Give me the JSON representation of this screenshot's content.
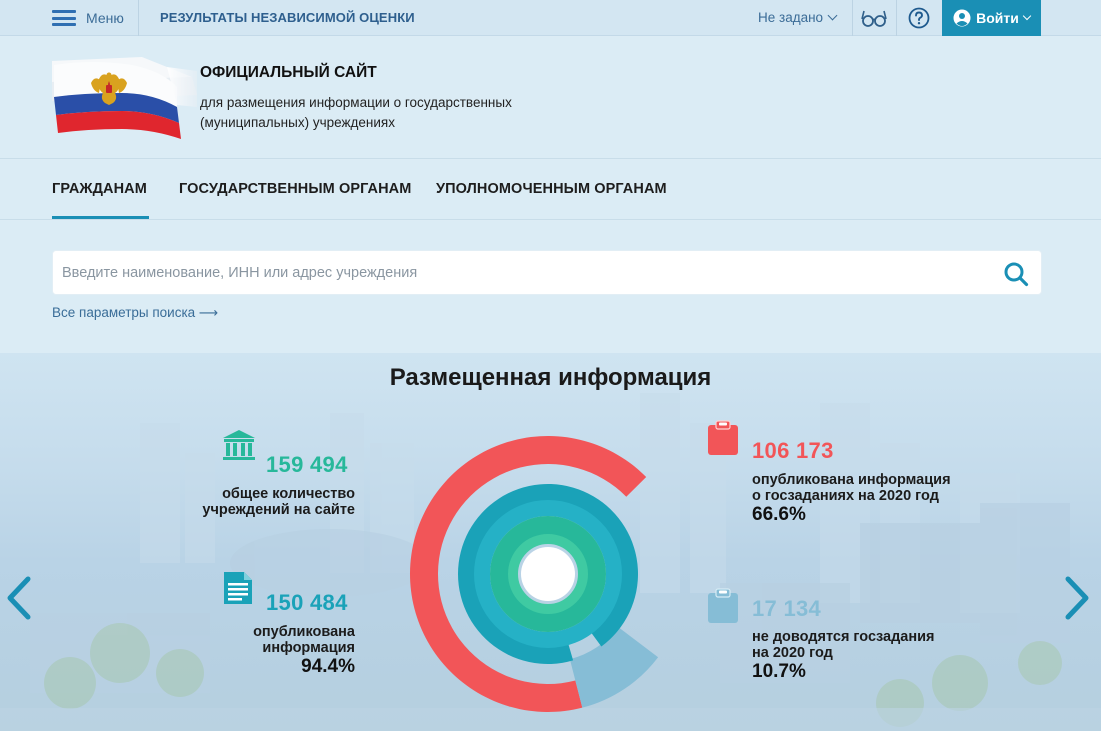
{
  "topbar": {
    "menu_label": "Меню",
    "results_link": "РЕЗУЛЬТАТЫ НЕЗАВИСИМОЙ ОЦЕНКИ",
    "region_label": "Не задано",
    "login_label": "Войти"
  },
  "header": {
    "site_title": "ОФИЦИАЛЬНЫЙ САЙТ",
    "site_subtitle": "для размещения информации о государственных (муниципальных) учреждениях"
  },
  "tabs": [
    {
      "label": "ГРАЖДАНАМ",
      "active": true
    },
    {
      "label": "ГОСУДАРСТВЕННЫМ ОРГАНАМ",
      "active": false
    },
    {
      "label": "УПОЛНОМОЧЕННЫМ ОРГАНАМ",
      "active": false
    }
  ],
  "search": {
    "placeholder": "Введите наименование, ИНН или адрес учреждения",
    "advanced_link": "Все параметры поиска ⟶"
  },
  "hero": {
    "title": "Размещенная информация",
    "stats": {
      "institutions": {
        "value": "159 494",
        "label_line1": "общее количество",
        "label_line2": "учреждений на сайте",
        "color": "#27b89a"
      },
      "published": {
        "value": "150 484",
        "label_line1": "опубликована",
        "label_line2": "информация",
        "percent": "94.4%",
        "color": "#1aa2b8"
      },
      "tasks_published": {
        "value": "106 173",
        "label_line1": "опубликована информация",
        "label_line2": "о госзаданиях на 2020 год",
        "percent": "66.6%",
        "color": "#f25558"
      },
      "tasks_not_assigned": {
        "value": "17 134",
        "label_line1": "не доводятся госзадания",
        "label_line2": "на 2020 год",
        "percent": "10.7%",
        "color": "#86bdd6"
      }
    },
    "ring_shares": {
      "tasks_published_pct": 66.6,
      "published_pct": 94.4,
      "tasks_not_assigned_pct": 10.7,
      "institutions_pct": 100
    }
  },
  "colors": {
    "accent": "#1a8fb5",
    "red": "#f25558",
    "teal": "#1aa2b8",
    "green": "#27b89a",
    "light_blue": "#86bdd6"
  },
  "icons": [
    "menu-icon",
    "glasses-icon",
    "help-icon",
    "user-icon",
    "search-icon",
    "bank-icon",
    "document-icon",
    "clipboard-icon",
    "arrow-left-icon",
    "arrow-right-icon"
  ]
}
